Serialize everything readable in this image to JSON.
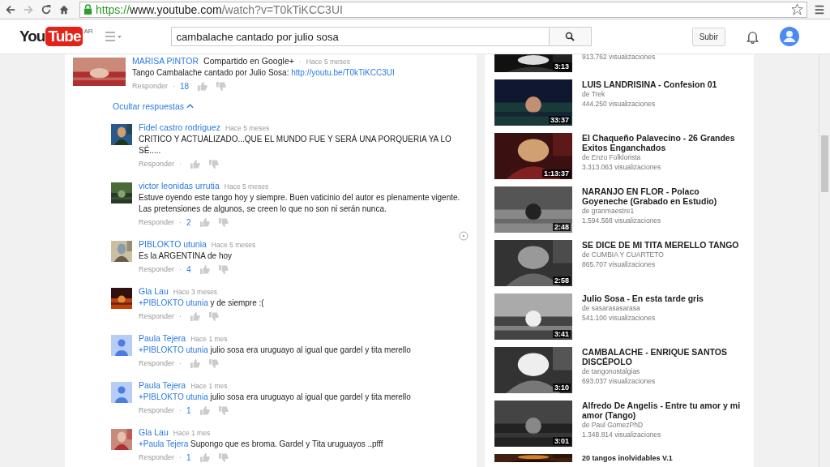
{
  "browser": {
    "scheme": "https://",
    "host": "www.youtube.com",
    "path": "/watch?v=T0kTiKCC3UI"
  },
  "header": {
    "logo_you": "You",
    "logo_tube": "Tube",
    "region": "AR",
    "search_value": "cambalache cantado por julio sosa",
    "upload": "Subir"
  },
  "comment": {
    "author": "MARISA PINTOR",
    "shared": "Compartido en Google+",
    "separator": "·",
    "time": "Hace 5 meses",
    "text": "Tango Cambalache cantado por Julio Sosa: ",
    "link": "http://youtu.be/T0kTiKCC3UI",
    "reply": "Responder",
    "dot": "·",
    "likes": "18"
  },
  "toggle": {
    "label": "Ocultar respuestas",
    "expanded": true
  },
  "replies": [
    {
      "author": "Fidel castro rodriguez",
      "time": "Hace 5 meses",
      "text": "CRITICO Y ACTUALIZADO...QUE EL MUNDO FUE Y SERÁ UNA PORQUERIA YA LO SÉ.....",
      "reply": "Responder",
      "dot": "·"
    },
    {
      "author": "victor leonidas urrutia",
      "time": "Hace 5 meses",
      "text": "Estuve oyendo este tango hoy y siempre. Buen vaticinio del autor  es plenamente vigente. Las pretensiones de algunos, se creen lo que no son ni serán nunca.",
      "reply": "Responder",
      "dot": "·",
      "likes": "2"
    },
    {
      "author": "PIBLOKTO utunia",
      "time": "Hace 5 meses",
      "text": "Es la ARGENTINA de hoy",
      "reply": "Responder",
      "dot": "·",
      "likes": "4"
    },
    {
      "author": "Gla Lau",
      "time": "Hace 3 meses",
      "mention": "+PIBLOKTO utunia",
      "text": " y de siempre :(",
      "reply": "Responder",
      "dot": "·"
    },
    {
      "kind": "default",
      "author": "Paula Tejera",
      "time": "Hace 1 mes",
      "mention": "+PIBLOKTO utunia",
      "text": " julio sosa era uruguayo al igual que gardel y tita merello",
      "reply": "Responder",
      "dot": "·"
    },
    {
      "kind": "default",
      "author": "Paula Tejera",
      "time": "Hace 1 mes",
      "mention": "+PIBLOKTO utunia",
      "text": " julio sosa era uruguayo al igual que gardel y tita merello",
      "reply": "Responder",
      "dot": "·",
      "likes": "1"
    },
    {
      "author": "Gla Lau",
      "time": "Hace 1 mes",
      "mention": "+Paula Tejera",
      "text": " Supongo que es broma. Gardel y Tita uruguayos ..pfff",
      "reply": "Responder",
      "dot": "·",
      "likes": "1"
    }
  ],
  "videos": [
    {
      "views": "913.762 visualizaciones",
      "duration": "3:13"
    },
    {
      "title": "LUIS LANDRISINA - Confesion 01",
      "channel": "de Trek",
      "views": "444.250 visualizaciones",
      "duration": "33:37"
    },
    {
      "title": "El Chaqueño Palavecino - 26 Grandes Exitos Enganchados",
      "channel": "de Enzo Folklorista",
      "views": "3.313.063 visualizaciones",
      "duration": "1:13:37"
    },
    {
      "title": "NARANJO EN FLOR - Polaco Goyeneche (Grabado en Estudio)",
      "channel": "de granmaestre1",
      "views": "1.594.568 visualizaciones",
      "duration": "2:48"
    },
    {
      "title": "SE DICE DE MI TITA MERELLO TANGO",
      "channel": "de CUMBIA Y CUARTETO",
      "views": "865.707 visualizaciones",
      "duration": "2:58"
    },
    {
      "title": "Julio Sosa - En esta tarde gris",
      "channel": "de sasarasasarasa",
      "views": "541.100 visualizaciones",
      "duration": "3:41"
    },
    {
      "title": "CAMBALACHE - ENRIQUE SANTOS DISCÉPOLO",
      "channel": "de tangonostalgias",
      "views": "693.037 visualizaciones",
      "duration": "3:10"
    },
    {
      "title": "Alfredo De Angelis - Entre tu amor y mi amor (Tango)",
      "channel": "de Paul GomezPhD",
      "views": "1.348.814 visualizaciones",
      "duration": "3:01"
    },
    {
      "title": "20 tangos inolvidables V.1"
    }
  ]
}
